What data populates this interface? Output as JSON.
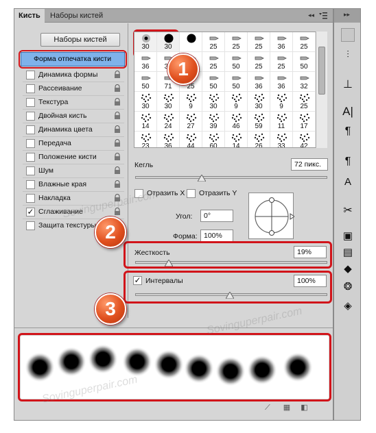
{
  "tabs": {
    "active": "Кисть",
    "inactive": "Наборы кистей"
  },
  "presets_button": "Наборы кистей",
  "options": [
    {
      "label": "Форма отпечатка кисти",
      "selected": true,
      "checked": false,
      "locked": false
    },
    {
      "label": "Динамика формы",
      "checked": false,
      "locked": true
    },
    {
      "label": "Рассеивание",
      "checked": false,
      "locked": true
    },
    {
      "label": "Текстура",
      "checked": false,
      "locked": true
    },
    {
      "label": "Двойная кисть",
      "checked": false,
      "locked": true
    },
    {
      "label": "Динамика цвета",
      "checked": false,
      "locked": true
    },
    {
      "label": "Передача",
      "checked": false,
      "locked": true
    },
    {
      "label": "Положение кисти",
      "checked": false,
      "locked": true
    },
    {
      "label": "Шум",
      "checked": false,
      "locked": true
    },
    {
      "label": "Влажные края",
      "checked": false,
      "locked": true
    },
    {
      "label": "Накладка",
      "checked": false,
      "locked": true
    },
    {
      "label": "Сглаживание",
      "checked": true,
      "locked": true
    },
    {
      "label": "Защита текстуры",
      "checked": false,
      "locked": true
    }
  ],
  "brush_grid": [
    [
      "30",
      "30",
      "",
      "25",
      "25",
      "25",
      "36",
      "25"
    ],
    [
      "36",
      "30",
      "",
      "25",
      "50",
      "25",
      "25",
      "50"
    ],
    [
      "50",
      "71",
      "25",
      "50",
      "50",
      "36",
      "36",
      "32"
    ],
    [
      "30",
      "30",
      "9",
      "30",
      "9",
      "30",
      "9",
      "25"
    ],
    [
      "14",
      "24",
      "27",
      "39",
      "46",
      "59",
      "11",
      "17"
    ],
    [
      "23",
      "36",
      "44",
      "60",
      "14",
      "26",
      "33",
      "42"
    ]
  ],
  "size": {
    "label": "Кегль",
    "value": "72 пикс."
  },
  "flip": {
    "x_label": "Отразить X",
    "y_label": "Отразить Y"
  },
  "angle": {
    "label": "Угол:",
    "value": "0°"
  },
  "roundness": {
    "label": "Форма:",
    "value": "100%"
  },
  "hardness": {
    "label": "Жесткость",
    "value": "19%"
  },
  "spacing": {
    "label": "Интервалы",
    "value": "100%",
    "checked": true
  },
  "callouts": [
    "1",
    "2",
    "3"
  ],
  "watermark": "Sovinguperpair.com",
  "colors": {
    "highlight": "#d1141a",
    "selected_row": "#7fb2ea"
  }
}
